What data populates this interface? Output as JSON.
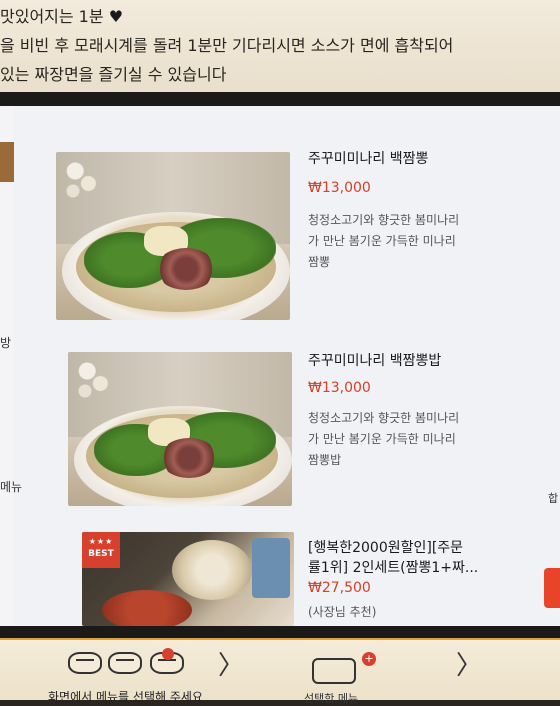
{
  "notice": {
    "line1": "맛있어지는 1분",
    "heart": "♥",
    "line2": "을 비빈 후 모래시계를 돌려 1분만 기다리시면 소스가 면에 흡착되어",
    "line3": "있는 짜장면을 즐기실 수 있습니다"
  },
  "side": {
    "left_text1": "방",
    "left_text2": "메뉴",
    "right_text": "합"
  },
  "menu": {
    "items": [
      {
        "name": "주꾸미미나리 백짬뽕",
        "price": "₩13,000",
        "desc": [
          "청정소고기와 향긋한 봄미나리",
          "가 만난 봄기운 가득한 미나리",
          "짬뽕"
        ]
      },
      {
        "name": "주꾸미미나리 백짬뽕밥",
        "price": "₩13,000",
        "desc": [
          "청정소고기와 향긋한 봄미나리",
          "가 만난 봄기운 가득한 미나리",
          "짬뽕밥"
        ]
      },
      {
        "name_lines": [
          "[행복한2000원할인][주문",
          "률1위] 2인세트(짬뽕1+짜..."
        ],
        "price": "₩27,500",
        "sub": "(사장님 추천)",
        "badge_stars": "★★★",
        "badge_label": "BEST"
      }
    ]
  },
  "bottom": {
    "instruction": "화면에서 메뉴를 선택해 주세요",
    "instruction2": "선택한 메뉴",
    "chevron": "〉",
    "plus": "+"
  },
  "colors": {
    "price_red": "#d4402b",
    "accent_red": "#d6402c",
    "screen_bg": "#f1f2f6"
  }
}
